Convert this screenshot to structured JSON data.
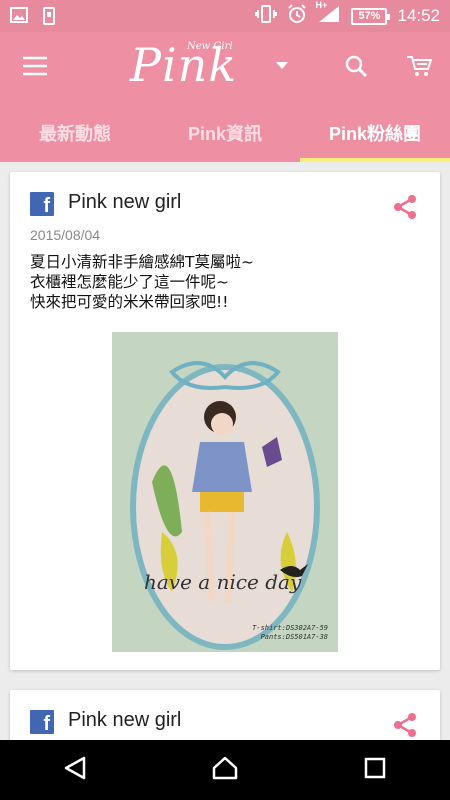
{
  "status_bar": {
    "time": "14:52",
    "battery": "57%",
    "network": "H+",
    "icons": [
      "image-icon",
      "phone-storage-icon",
      "vibrate-icon",
      "alarm-icon",
      "signal-icon"
    ]
  },
  "toolbar": {
    "logo_text": "Pink",
    "logo_subtext": "New Girl",
    "icons": [
      "menu-icon",
      "search-icon",
      "cart-icon",
      "dropdown-caret-icon"
    ]
  },
  "tabs": [
    {
      "label": "最新動態",
      "active": false
    },
    {
      "label": "Pink資訊",
      "active": false
    },
    {
      "label": "Pink粉絲團",
      "active": true
    }
  ],
  "posts": [
    {
      "author": "Pink new girl",
      "date": "2015/08/04",
      "text": "夏日小清新非手繪感綿T莫屬啦~\n衣櫃裡怎麼能少了這一件呢~\n快來把可愛的米米帶回家吧!!",
      "image_caption": "have a nice day",
      "image_small_text": "T-shirt:DS302A7-59\nPants:DS501A7-38"
    },
    {
      "author": "Pink new girl"
    }
  ],
  "colors": {
    "accent": "#ee8fa3",
    "status_bar": "#e88a9e",
    "tab_indicator": "#f6ef7a",
    "facebook": "#4267b2"
  }
}
